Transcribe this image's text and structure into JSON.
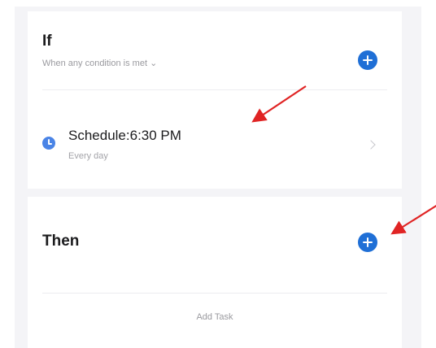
{
  "if_section": {
    "title": "If",
    "subtitle": "When any condition is met ⌄",
    "condition": {
      "title": "Schedule:6:30 PM",
      "subtitle": "Every day",
      "icon": "clock-icon"
    }
  },
  "then_section": {
    "title": "Then",
    "add_task_label": "Add Task"
  },
  "colors": {
    "accent": "#1f6fd6",
    "clock": "#4a84e6",
    "annotation_arrow": "#e02424"
  }
}
